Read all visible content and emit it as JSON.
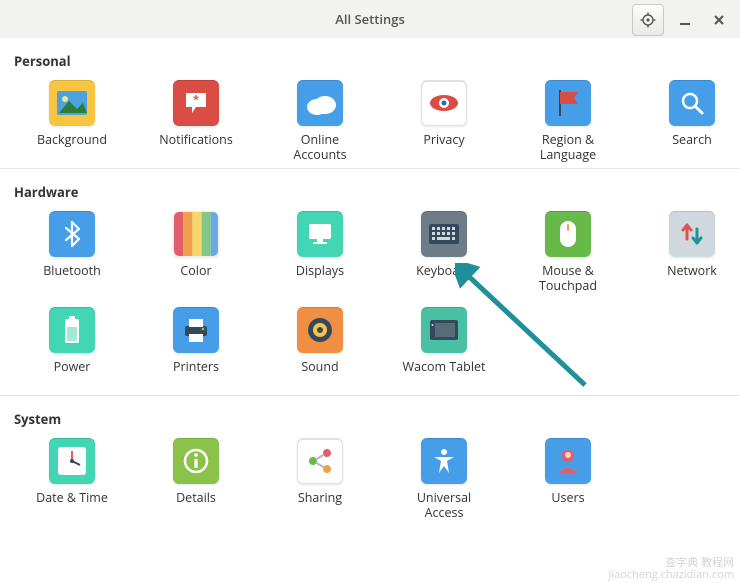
{
  "window": {
    "title": "All Settings"
  },
  "sections": {
    "personal": {
      "title": "Personal",
      "items": [
        {
          "label": "Background"
        },
        {
          "label": "Notifications"
        },
        {
          "label": "Online\nAccounts"
        },
        {
          "label": "Privacy"
        },
        {
          "label": "Region &\nLanguage"
        },
        {
          "label": "Search"
        }
      ]
    },
    "hardware": {
      "title": "Hardware",
      "items": [
        {
          "label": "Bluetooth"
        },
        {
          "label": "Color"
        },
        {
          "label": "Displays"
        },
        {
          "label": "Keyboard"
        },
        {
          "label": "Mouse &\nTouchpad"
        },
        {
          "label": "Network"
        },
        {
          "label": "Power"
        },
        {
          "label": "Printers"
        },
        {
          "label": "Sound"
        },
        {
          "label": "Wacom Tablet"
        }
      ]
    },
    "system": {
      "title": "System",
      "items": [
        {
          "label": "Date & Time"
        },
        {
          "label": "Details"
        },
        {
          "label": "Sharing"
        },
        {
          "label": "Universal\nAccess"
        },
        {
          "label": "Users"
        }
      ]
    }
  },
  "annotation": {
    "type": "arrow",
    "target": "Keyboard",
    "color": "#1f8f9a"
  },
  "watermark": {
    "line1": "查字典 教程网",
    "line2": "jiaocheng.chazidian.com"
  }
}
